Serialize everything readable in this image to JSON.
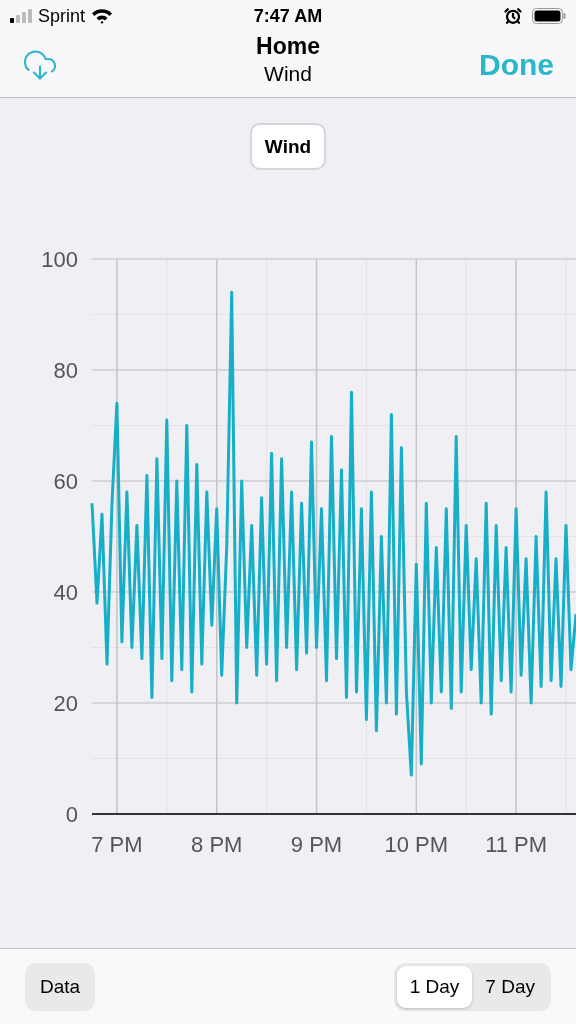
{
  "status_bar": {
    "carrier": "Sprint",
    "time": "7:47 AM"
  },
  "nav": {
    "title": "Home",
    "subtitle": "Wind",
    "done": "Done"
  },
  "chart_selector": {
    "label": "Wind"
  },
  "chart": {
    "chart_data": {
      "type": "line",
      "categories": [
        null,
        null,
        null,
        null,
        null,
        "7 PM",
        null,
        null,
        null,
        null,
        null,
        null,
        null,
        null,
        null,
        null,
        null,
        null,
        null,
        null,
        null,
        null,
        null,
        null,
        null,
        "8 PM",
        null,
        null,
        null,
        null,
        null,
        null,
        null,
        null,
        null,
        null,
        null,
        null,
        null,
        null,
        null,
        null,
        null,
        null,
        null,
        "9 PM",
        null,
        null,
        null,
        null,
        null,
        null,
        null,
        null,
        null,
        null,
        null,
        null,
        null,
        null,
        null,
        null,
        null,
        null,
        null,
        "10 PM",
        null,
        null,
        null,
        null,
        null,
        null,
        null,
        null,
        null,
        null,
        null,
        null,
        null,
        null,
        null,
        null,
        null,
        null,
        null,
        "11 PM",
        null,
        null,
        null,
        null,
        null,
        null,
        null,
        null,
        null,
        null,
        null,
        null
      ],
      "series": [
        {
          "color": "#17aec8",
          "values": [
            56,
            38,
            54,
            27,
            56,
            74,
            31,
            58,
            30,
            52,
            28,
            61,
            21,
            64,
            28,
            71,
            24,
            60,
            26,
            70,
            22,
            63,
            27,
            58,
            34,
            55,
            25,
            48,
            94,
            20,
            60,
            30,
            52,
            25,
            57,
            27,
            65,
            24,
            64,
            30,
            58,
            26,
            56,
            29,
            67,
            30,
            55,
            24,
            68,
            28,
            62,
            21,
            76,
            22,
            55,
            17,
            58,
            15,
            50,
            20,
            72,
            18,
            66,
            22,
            7,
            45,
            9,
            56,
            20,
            48,
            22,
            55,
            19,
            68,
            22,
            52,
            26,
            46,
            20,
            56,
            18,
            52,
            24,
            48,
            22,
            55,
            25,
            46,
            20,
            50,
            23,
            58,
            24,
            46,
            23,
            52,
            26,
            36
          ]
        }
      ],
      "ylim": [
        0,
        100
      ],
      "grid": true,
      "yticks": [
        0,
        20,
        40,
        60,
        80,
        100
      ]
    }
  },
  "toolbar": {
    "data_button": "Data",
    "ranges": [
      {
        "label": "1 Day",
        "selected": true
      },
      {
        "label": "7 Day",
        "selected": false
      }
    ]
  }
}
